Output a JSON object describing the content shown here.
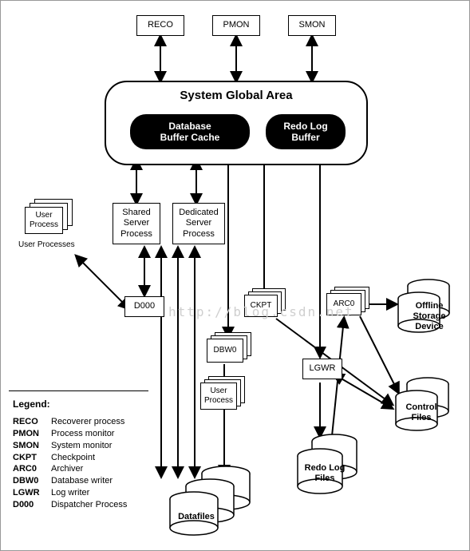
{
  "top_processes": {
    "reco": "RECO",
    "pmon": "PMON",
    "smon": "SMON"
  },
  "sga": {
    "title": "System Global Area",
    "buffer_cache": "Database\nBuffer Cache",
    "redo_log_buffer": "Redo Log\nBuffer"
  },
  "procs": {
    "user_process": "User\nProcess",
    "user_processes_label": "User Processes",
    "shared_server": "Shared\nServer\nProcess",
    "dedicated_server": "Dedicated\nServer\nProcess",
    "d000": "D000",
    "ckpt": "CKPT",
    "dbw0": "DBW0",
    "lgwr": "LGWR",
    "arc0": "ARC0",
    "user_process_2": "User\nProcess"
  },
  "storage": {
    "offline": "Offline\nStorage\nDevice",
    "control_files": "Control\nFiles",
    "redo_log_files": "Redo Log\nFiles",
    "datafiles": "Datafiles"
  },
  "legend": {
    "title": "Legend:",
    "rows": [
      {
        "abbr": "RECO",
        "desc": "Recoverer process"
      },
      {
        "abbr": "PMON",
        "desc": "Process monitor"
      },
      {
        "abbr": "SMON",
        "desc": "System monitor"
      },
      {
        "abbr": "CKPT",
        "desc": "Checkpoint"
      },
      {
        "abbr": "ARC0",
        "desc": "Archiver"
      },
      {
        "abbr": "DBW0",
        "desc": "Database writer"
      },
      {
        "abbr": "LGWR",
        "desc": "Log writer"
      },
      {
        "abbr": "D000",
        "desc": "Dispatcher Process"
      }
    ]
  },
  "watermark": "http://blog.csdn.net"
}
